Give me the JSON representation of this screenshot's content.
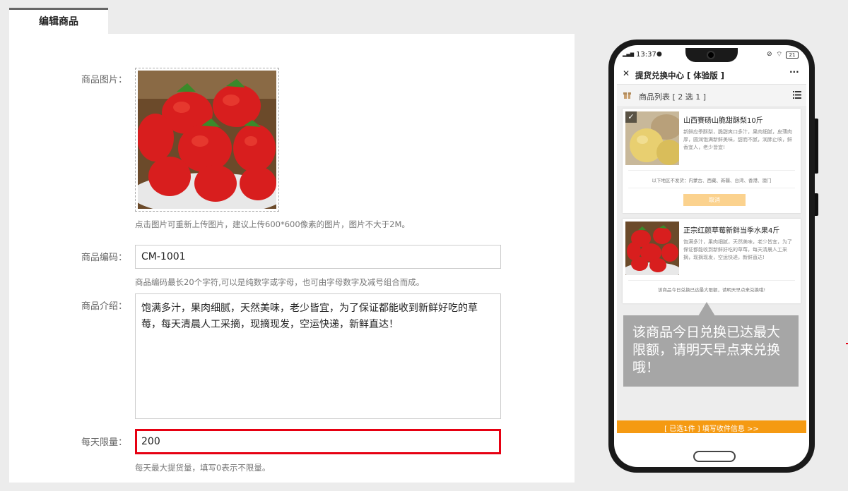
{
  "tab": {
    "label": "编辑商品"
  },
  "form": {
    "image_label": "商品图片：",
    "image_hint": "点击图片可重新上传图片，建议上传600*600像素的图片，图片不大于2M。",
    "code_label": "商品编码：",
    "code_value": "CM-1001",
    "code_hint": "商品编码最长20个字符,可以是纯数字或字母，也可由字母数字及减号组合而成。",
    "intro_label": "商品介绍：",
    "intro_value": "饱满多汁，果肉细腻，天然美味，老少皆宜，为了保证都能收到新鲜好吃的草莓，每天清晨人工采摘，现摘现发，空运快递，新鲜直达！",
    "limit_label": "每天限量：",
    "limit_value": "200",
    "limit_hint": "每天最大提货量，填写0表示不限量。"
  },
  "phone": {
    "status_time": "13:37",
    "battery": "21",
    "nav_close": "✕",
    "nav_title": "提货兑换中心 [ 体验版 ]",
    "nav_more": "···",
    "list_title": "商品列表 [ 2 选 1 ]",
    "cards": [
      {
        "title": "山西赛砀山脆甜酥梨10斤",
        "desc": "新鲜应季酥梨，脆甜爽口多汁，果肉细腻，皮薄肉厚，圆润饱满新鲜美味，甜而不腻，润肺止咳，鲜香宜人，老少皆宜!",
        "note": "以下地区不发货：内蒙古、西藏、新疆、台湾、香港、澳门",
        "button": "取消",
        "check": "✓"
      },
      {
        "title": "正宗红颜草莓新鲜当季水果4斤",
        "desc": "饱满多汁，果肉细腻，天然美味，老少皆宜，为了保证都能收到新鲜好吃的草莓，每天清晨人工采摘，现摘现发，空运快递，新鲜直达!",
        "note": "该商品今日兑换已达最大限额，请明天早点来兑换哦!"
      }
    ],
    "bottom_bar": "[ 已选1件 ] 填写收件信息 >>"
  },
  "tooltip": {
    "text": "该商品今日兑换已达最大限额，请明天早点来兑换哦！"
  },
  "colors": {
    "accent_orange": "#f59a12",
    "highlight_red": "#e60012",
    "tooltip_gray": "#a6a6a6"
  }
}
